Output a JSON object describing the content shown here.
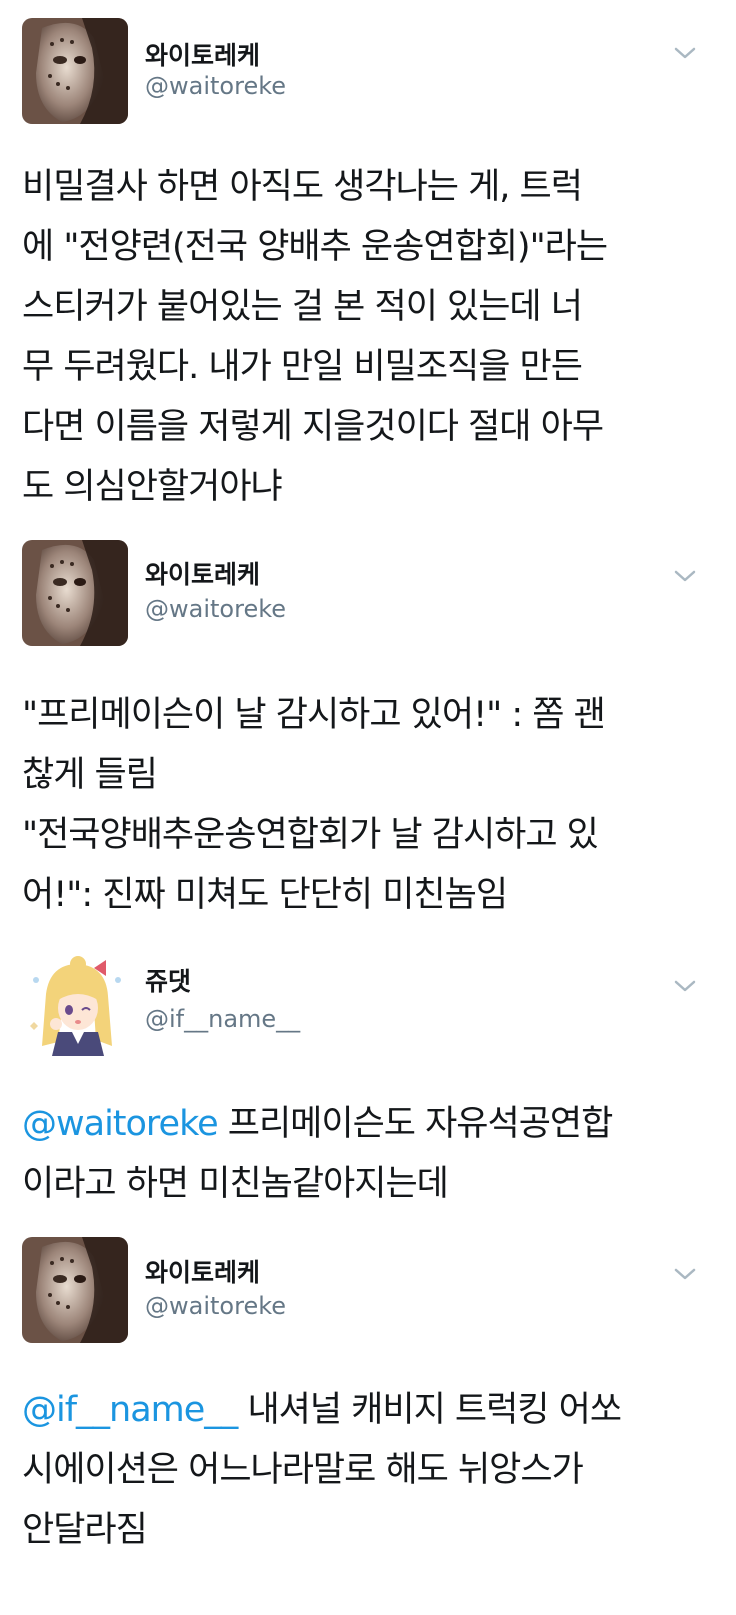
{
  "tweets": [
    {
      "name": "와이토레케",
      "handle": "@waitoreke",
      "avatar_icon": "masked-face-avatar-icon",
      "menu_icon": "chevron-down-icon",
      "lines": [
        "비밀결사 하면 아직도 생각나는 게, 트럭",
        "에 \"전양련(전국 양배추 운송연합회)\"라는",
        "스티커가 붙어있는 걸 본 적이 있는데 너",
        "무 두려웠다. 내가 만일 비밀조직을 만든",
        "다면 이름을 저렇게 지을것이다 절대 아무",
        "도 의심안할거아냐"
      ]
    },
    {
      "name": "와이토레케",
      "handle": "@waitoreke",
      "avatar_icon": "masked-face-avatar-icon",
      "menu_icon": "chevron-down-icon",
      "lines": [
        "\"프리메이슨이 날 감시하고 있어!\" : 쫌 괜",
        "찮게 들림",
        "\"전국양배추운송연합회가 날 감시하고 있",
        "어!\": 진짜 미쳐도 단단히 미친놈임"
      ]
    },
    {
      "name": "쥬댓",
      "handle": "@if__name__",
      "avatar_icon": "anime-girl-avatar-icon",
      "menu_icon": "chevron-down-icon",
      "mention": "@waitoreke",
      "first_line_rest": " 프리메이슨도 자유석공연합",
      "lines": [
        "이라고 하면  미친놈같아지는데"
      ]
    },
    {
      "name": "와이토레케",
      "handle": "@waitoreke",
      "avatar_icon": "masked-face-avatar-icon",
      "menu_icon": "chevron-down-icon",
      "mention": "@if__name__",
      "first_line_rest": " 내셔널 캐비지 트럭킹 어쏘",
      "lines": [
        "시에이션은 어느나라말로 해도 뉘앙스가",
        "안달라짐"
      ]
    }
  ],
  "colors": {
    "mention": "#1b95e0",
    "handle": "#657786",
    "text": "#14171a",
    "chevron": "#aab8c2"
  }
}
